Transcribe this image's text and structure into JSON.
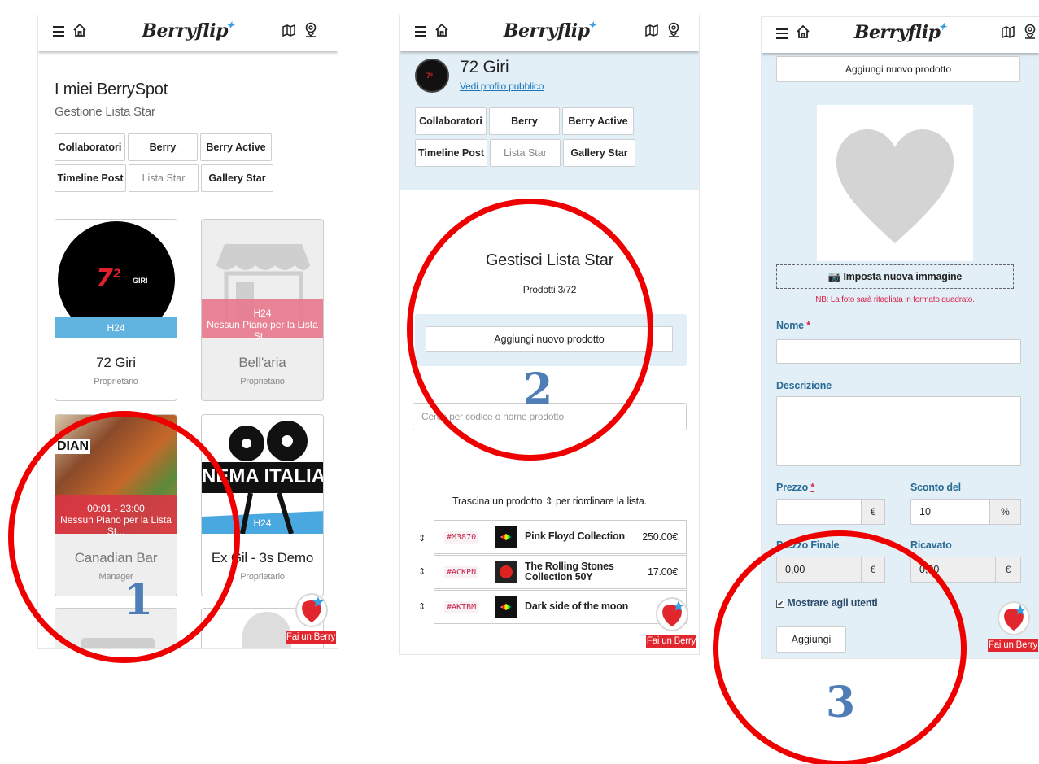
{
  "app": {
    "logo": "Berryflip"
  },
  "panel1": {
    "title": "I miei BerrySpot",
    "subtitle": "Gestione Lista Star",
    "tabs": [
      "Collaboratori",
      "Berry",
      "Berry Active",
      "Timeline Post",
      "Lista Star",
      "Gallery Star"
    ],
    "active_tab": "Lista Star",
    "cards": [
      {
        "name": "72 Giri",
        "role": "Proprietario",
        "band": "H24",
        "logo_text": "7",
        "logo_sup": "2",
        "logo_word": "GIRI"
      },
      {
        "name": "Bell'aria",
        "role": "Proprietario",
        "band_line1": "H24",
        "band_line2": "Nessun Piano per la Lista St..."
      },
      {
        "name": "Canadian Bar",
        "role": "Manager",
        "band_line1": "00:01 - 23:00",
        "band_line2": "Nessun Piano per la Lista St...",
        "img_text": "DIAN"
      },
      {
        "name": "Ex Gil - 3s Demo",
        "role": "Proprietario",
        "band": "H24",
        "img_text": "NEMA ITALIA"
      }
    ]
  },
  "panel2": {
    "name": "72 Giri",
    "link": "Vedi profilo pubblico",
    "tabs": [
      "Collaboratori",
      "Berry",
      "Berry Active",
      "Timeline Post",
      "Lista Star",
      "Gallery Star"
    ],
    "heading": "Gestisci Lista Star",
    "count": "Prodotti 3/72",
    "add_button": "Aggiungi nuovo prodotto",
    "search_placeholder": "Cerca per codice o nome prodotto",
    "drag_hint": "Trascina un prodotto ⇕ per riordinare la lista.",
    "products": [
      {
        "code": "#M3870",
        "title": "Pink Floyd Collection",
        "price": "250.00€"
      },
      {
        "code": "#ACKPN",
        "title": "The Rolling Stones Collection 50Y",
        "price": "17.00€"
      },
      {
        "code": "#AKTBM",
        "title": "Dark side of the moon",
        "price": ""
      }
    ]
  },
  "panel3": {
    "add_button": "Aggiungi nuovo prodotto",
    "image_button": "Imposta nuova immagine",
    "note": "NB: La foto sarà ritagliata in formato quadrato.",
    "label_name": "Nome",
    "label_desc": "Descrizione",
    "label_price": "Prezzo",
    "label_discount": "Sconto del",
    "discount_value": "10",
    "label_final": "Prezzo Finale",
    "final_value": "0,00",
    "label_earn": "Ricavato",
    "earn_value": "0,00",
    "currency": "€",
    "percent": "%",
    "req": "*",
    "show_label": "Mostrare agli utenti",
    "submit": "Aggiungi"
  },
  "fab_label": "Fai un Berry",
  "annotations": [
    "1",
    "2",
    "3"
  ],
  "colors": {
    "accent_red": "#ee0000",
    "annot_blue": "#4f7db6",
    "light_blue": "#e3eff7",
    "band_blue": "#62b4e0"
  }
}
